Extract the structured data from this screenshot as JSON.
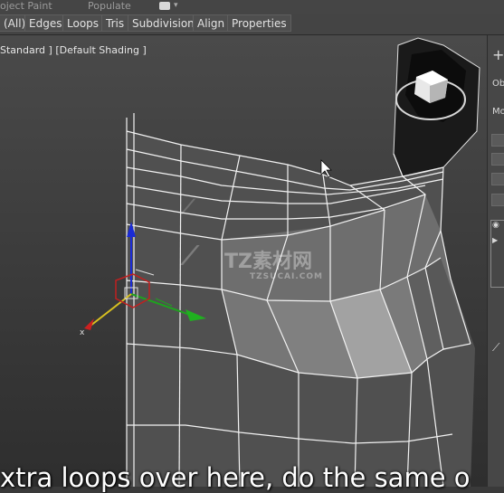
{
  "menubar": {
    "object_paint": "oject Paint",
    "populate": "Populate"
  },
  "toolbar": {
    "buttons": [
      "(All)",
      "Edges",
      "Loops",
      "Tris",
      "Subdivision",
      "Align",
      "Properties"
    ]
  },
  "viewport": {
    "label": "Standard ] [Default Shading ]"
  },
  "right_panel": {
    "plus": "+",
    "tab1": "Ob",
    "tab2": "Mo"
  },
  "watermark": {
    "brand": "TZ素材网",
    "url": "TZSUCAI.COM"
  },
  "subtitle": {
    "text": "xtra loops over here, do the same o"
  }
}
